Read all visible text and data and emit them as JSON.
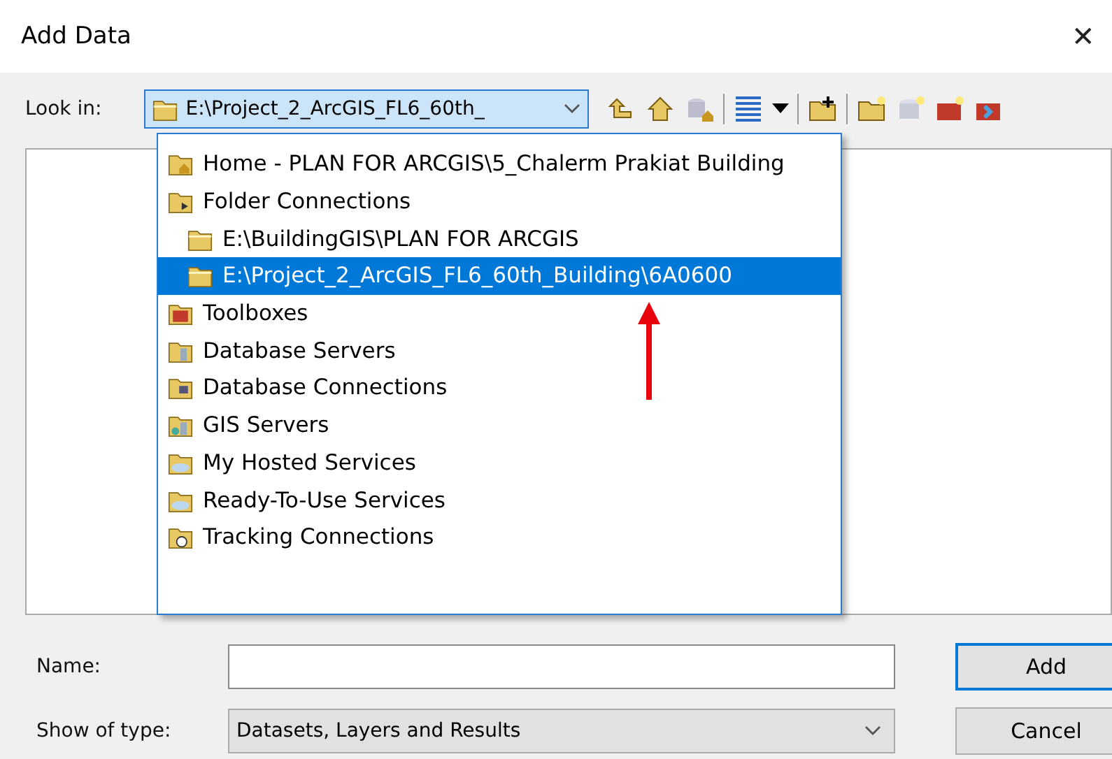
{
  "window": {
    "title": "Add Data",
    "close": "✕"
  },
  "look_in": {
    "label": "Look in:",
    "value": "E:\\Project_2_ArcGIS_FL6_60th_"
  },
  "dropdown_items": [
    {
      "kind": "home",
      "label": "Home - PLAN FOR ARCGIS\\5_Chalerm Prakiat Building",
      "selected": false
    },
    {
      "kind": "folderconn",
      "label": "Folder Connections",
      "selected": false,
      "children": [
        {
          "kind": "folder",
          "label": "E:\\BuildingGIS\\PLAN FOR ARCGIS",
          "selected": false
        },
        {
          "kind": "folder",
          "label": "E:\\Project_2_ArcGIS_FL6_60th_Building\\6A0600",
          "selected": true
        }
      ]
    },
    {
      "kind": "toolbox",
      "label": "Toolboxes",
      "selected": false
    },
    {
      "kind": "dbserver",
      "label": "Database Servers",
      "selected": false
    },
    {
      "kind": "dbconn",
      "label": "Database Connections",
      "selected": false
    },
    {
      "kind": "gisserver",
      "label": "GIS Servers",
      "selected": false
    },
    {
      "kind": "cloud",
      "label": "My Hosted Services",
      "selected": false
    },
    {
      "kind": "cloud",
      "label": "Ready-To-Use Services",
      "selected": false
    },
    {
      "kind": "tracking",
      "label": "Tracking Connections",
      "selected": false
    }
  ],
  "name_field": {
    "label": "Name:"
  },
  "type_field": {
    "label": "Show of type:",
    "value": "Datasets, Layers and Results"
  },
  "buttons": [
    {
      "label": "Add",
      "default": true
    },
    {
      "label": "Cancel",
      "default": false
    }
  ]
}
